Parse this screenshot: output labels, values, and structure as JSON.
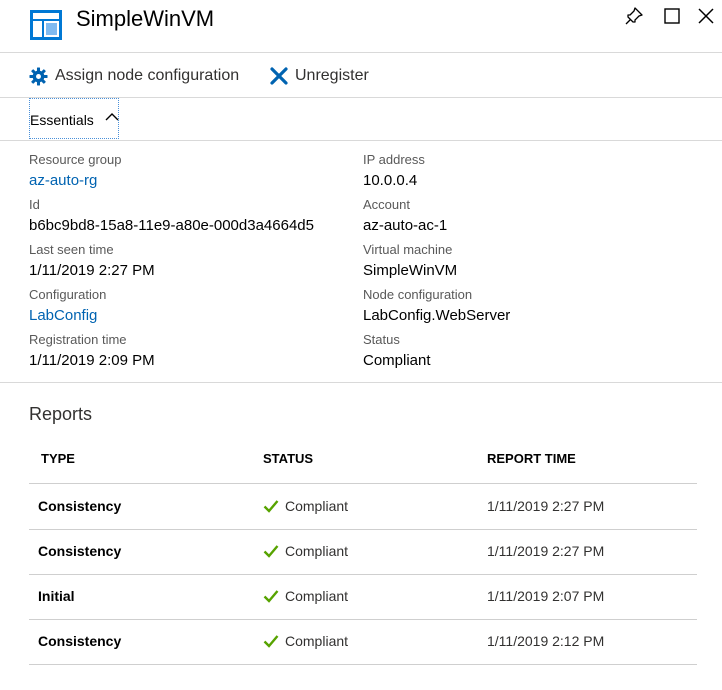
{
  "header": {
    "title": "SimpleWinVM",
    "icon": "virtual-machine-icon",
    "pin_icon": "pin-icon",
    "maximize_icon": "maximize-icon",
    "close_icon": "close-icon"
  },
  "commands": {
    "assign_label": "Assign node configuration",
    "assign_icon": "gear-icon",
    "unregister_label": "Unregister",
    "unregister_icon": "x-icon"
  },
  "essentials": {
    "label": "Essentials",
    "left": [
      {
        "key": "Resource group",
        "value": "az-auto-rg",
        "link": true
      },
      {
        "key": "Id",
        "value": "b6bc9bd8-15a8-11e9-a80e-000d3a4664d5",
        "link": false
      },
      {
        "key": "Last seen time",
        "value": "1/11/2019 2:27 PM",
        "link": false
      },
      {
        "key": "Configuration",
        "value": "LabConfig",
        "link": true
      },
      {
        "key": "Registration time",
        "value": "1/11/2019 2:09 PM",
        "link": false
      }
    ],
    "right": [
      {
        "key": "IP address",
        "value": "10.0.0.4",
        "link": false
      },
      {
        "key": "Account",
        "value": "az-auto-ac-1",
        "link": false
      },
      {
        "key": "Virtual machine",
        "value": "SimpleWinVM",
        "link": false
      },
      {
        "key": "Node configuration",
        "value": "LabConfig.WebServer",
        "link": false
      },
      {
        "key": "Status",
        "value": "Compliant",
        "link": false
      }
    ]
  },
  "reports": {
    "heading": "Reports",
    "columns": [
      "TYPE",
      "STATUS",
      "REPORT TIME"
    ],
    "rows": [
      {
        "type": "Consistency",
        "status": "Compliant",
        "time": "1/11/2019 2:27 PM"
      },
      {
        "type": "Consistency",
        "status": "Compliant",
        "time": "1/11/2019 2:27 PM"
      },
      {
        "type": "Initial",
        "status": "Compliant",
        "time": "1/11/2019 2:07 PM"
      },
      {
        "type": "Consistency",
        "status": "Compliant",
        "time": "1/11/2019 2:12 PM"
      }
    ]
  },
  "colors": {
    "accent": "#0063b1",
    "status_ok": "#57a300"
  }
}
